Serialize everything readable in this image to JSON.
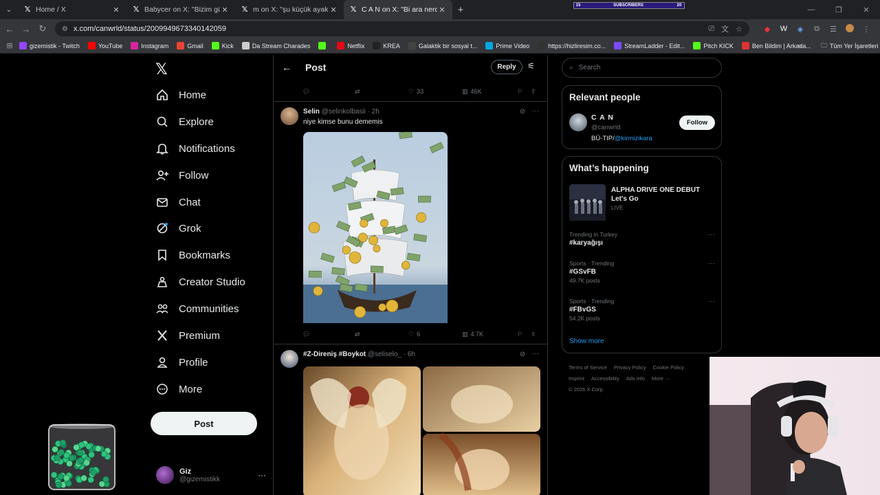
{
  "browser": {
    "tabs": [
      {
        "title": "Home / X",
        "active": false
      },
      {
        "title": "Babycer on X: \"Bizim güven yer",
        "active": false
      },
      {
        "title": "m on X: \"şu küçük ayak hareke",
        "active": false
      },
      {
        "title": "C A N on X: \"Bi ara nerdeyse t",
        "active": true
      }
    ],
    "subscriber_bar": {
      "left": "15",
      "label": "SUBSCRIBERS",
      "right": "20",
      "progress": 0.75
    },
    "url": "x.com/canwrld/status/2009949673340142059",
    "bookmarks": [
      {
        "label": "gizemistik - Twitch",
        "color": "#9146ff",
        "icon": "twitch-icon"
      },
      {
        "label": "YouTube",
        "color": "#ff0000",
        "icon": "youtube-icon"
      },
      {
        "label": "Instagram",
        "color": "#d6249f",
        "icon": "instagram-icon"
      },
      {
        "label": "Gmail",
        "color": "#ea4335",
        "icon": "gmail-icon"
      },
      {
        "label": "Kick",
        "color": "#53fc18",
        "icon": "kick-icon"
      },
      {
        "label": "Da Stream Charades",
        "color": "#cccccc",
        "icon": "puzzle-icon"
      },
      {
        "label": "",
        "color": "#53fc18",
        "icon": "kick-icon"
      },
      {
        "label": "Netflix",
        "color": "#e50914",
        "icon": "netflix-icon"
      },
      {
        "label": "KREA",
        "color": "#222222",
        "icon": "krea-icon"
      },
      {
        "label": "Galaktik bir sosyal t...",
        "color": "#444444",
        "icon": "zk-icon"
      },
      {
        "label": "Prime Video",
        "color": "#00a8e1",
        "icon": "prime-icon"
      },
      {
        "label": "https://hizliresim.co...",
        "color": "#333333",
        "icon": "h-icon"
      },
      {
        "label": "StreamLadder - Edit...",
        "color": "#7b4bff",
        "icon": "streamladder-icon"
      },
      {
        "label": "Pitch KICK",
        "color": "#53fc18",
        "icon": "kick-icon"
      },
      {
        "label": "Ben Bildim | Arkada...",
        "color": "#d33",
        "icon": "benbildim-icon"
      }
    ],
    "all_bookmarks": "Tüm Yer İşaretleri"
  },
  "nav": {
    "items": [
      {
        "label": "Home",
        "icon": "home-icon"
      },
      {
        "label": "Explore",
        "icon": "search-icon"
      },
      {
        "label": "Notifications",
        "icon": "bell-icon"
      },
      {
        "label": "Follow",
        "icon": "follow-icon"
      },
      {
        "label": "Chat",
        "icon": "mail-icon"
      },
      {
        "label": "Grok",
        "icon": "grok-icon"
      },
      {
        "label": "Bookmarks",
        "icon": "bookmark-icon"
      },
      {
        "label": "Creator Studio",
        "icon": "creator-studio-icon"
      },
      {
        "label": "Communities",
        "icon": "communities-icon"
      },
      {
        "label": "Premium",
        "icon": "x-premium-icon"
      },
      {
        "label": "Profile",
        "icon": "profile-icon"
      },
      {
        "label": "More",
        "icon": "more-circle-icon"
      }
    ],
    "post_button": "Post",
    "account": {
      "name": "Giz",
      "handle": "@gizemistikk"
    }
  },
  "header": {
    "title": "Post",
    "reply_button": "Reply"
  },
  "top_actions": {
    "replies": "",
    "reposts": "",
    "likes": "33",
    "views": "46K"
  },
  "tweets": [
    {
      "name": "Selin",
      "handle": "@selinkolbasii",
      "time": "· 2h",
      "text": "niye kimse bunu dememis",
      "actions": {
        "replies": "",
        "reposts": "",
        "likes": "6",
        "views": "4.7K"
      }
    },
    {
      "name": "#Z-Direniş #Boykot",
      "handle": "@seliselo_",
      "time": "· 6h",
      "text": ""
    }
  ],
  "right": {
    "search_placeholder": "Search",
    "relevant_title": "Relevant people",
    "person": {
      "name": "C A N",
      "handle": "@canwrld",
      "bio_prefix": "BÜ-TIP/",
      "bio_link": "@kirmizikara",
      "follow": "Follow"
    },
    "happening_title": "What’s happening",
    "live": {
      "title": "ALPHA DRIVE ONE DEBUT Let's Go",
      "status": "LIVE"
    },
    "trends": [
      {
        "category": "Trending in Turkey",
        "tag": "#karyağışı",
        "count": ""
      },
      {
        "category": "Sports · Trending",
        "tag": "#GSvFB",
        "count": "49.7K posts"
      },
      {
        "category": "Sports · Trending",
        "tag": "#FBvGS",
        "count": "54.2K posts"
      }
    ],
    "show_more": "Show more",
    "footer": {
      "links": [
        "Terms of Service",
        "Privacy Policy",
        "Cookie Policy",
        "Imprint",
        "Accessibility",
        "Ads info",
        "More ···"
      ],
      "copyright": "© 2026 X Corp."
    }
  },
  "colors": {
    "accent": "#1d9bf0",
    "border": "#2f3336",
    "muted": "#71767b"
  }
}
